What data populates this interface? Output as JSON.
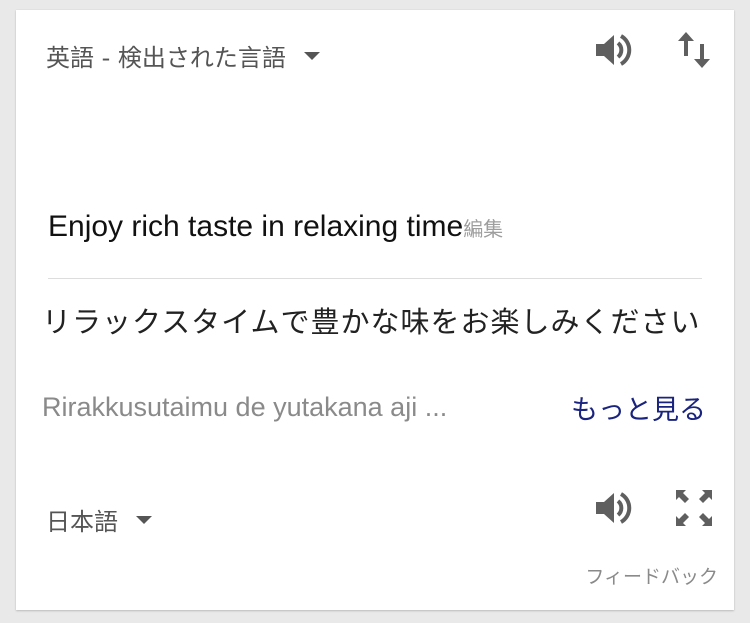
{
  "source": {
    "language_label": "英語 - 検出された言語",
    "text": "Enjoy rich taste in relaxing time",
    "edit_label": "編集"
  },
  "target": {
    "language_label": "日本語",
    "translation": "リラックスタイムで豊かな味をお楽しみください",
    "romanization": "Rirakkusutaimu de yutakana aji ...",
    "more_label": "もっと見る"
  },
  "feedback_label": "フィードバック",
  "icons": {
    "source_speaker": "speaker-icon",
    "swap": "swap-languages-icon",
    "target_speaker": "speaker-icon",
    "expand": "fullscreen-icon",
    "dropdown": "caret-down-icon"
  },
  "colors": {
    "link": "#1a237e",
    "muted_text": "#8a8a8a",
    "icon": "#5f5f5f"
  }
}
